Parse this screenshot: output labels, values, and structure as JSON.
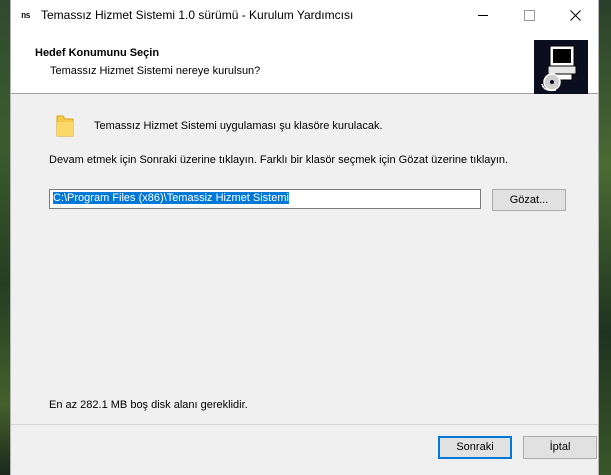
{
  "window": {
    "title": "Temassız Hizmet Sistemi 1.0 sürümü - Kurulum Yardımcısı",
    "app_icon_text": "ns"
  },
  "header": {
    "title": "Hedef Konumunu Seçin",
    "subtitle": "Temassız Hizmet Sistemi nereye kurulsun?"
  },
  "content": {
    "info": "Temassız Hizmet Sistemi uygulaması şu klasöre kurulacak.",
    "instruction": "Devam etmek için Sonraki üzerine tıklayın. Farklı bir klasör seçmek için Gözat üzerine tıklayın.",
    "path_value": "C:\\Program Files (x86)\\Temassiz Hizmet Sistemi",
    "browse_label": "Gözat...",
    "disk_space": "En az 282.1 MB boş disk alanı gereklidir."
  },
  "footer": {
    "next_label": "Sonraki",
    "cancel_label": "İptal"
  },
  "icons": {
    "folder": "folder-icon",
    "logo": "installer-logo-icon",
    "close": "close-icon",
    "minimize": "minimize-icon",
    "maximize": "maximize-icon"
  },
  "colors": {
    "accent": "#0078d7",
    "folder": "#f7c948",
    "logo_bg": "#0b0e1e"
  }
}
